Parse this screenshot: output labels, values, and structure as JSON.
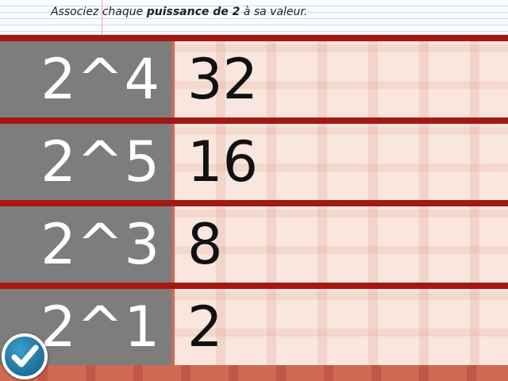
{
  "instruction": {
    "prefix": "Associez chaque ",
    "emphasis": "puissance de 2",
    "suffix": " à sa valeur."
  },
  "rows": [
    {
      "label": "2^4",
      "value": "32"
    },
    {
      "label": "2^5",
      "value": "16"
    },
    {
      "label": "2^3",
      "value": "8"
    },
    {
      "label": "2^1",
      "value": "2"
    }
  ],
  "icons": {
    "validate": "checkmark-icon"
  },
  "colors": {
    "label_bg": "#7d7d7d",
    "value_bg": "#f8e6df",
    "rule": "#a31912",
    "button": "#1f6f9a"
  }
}
